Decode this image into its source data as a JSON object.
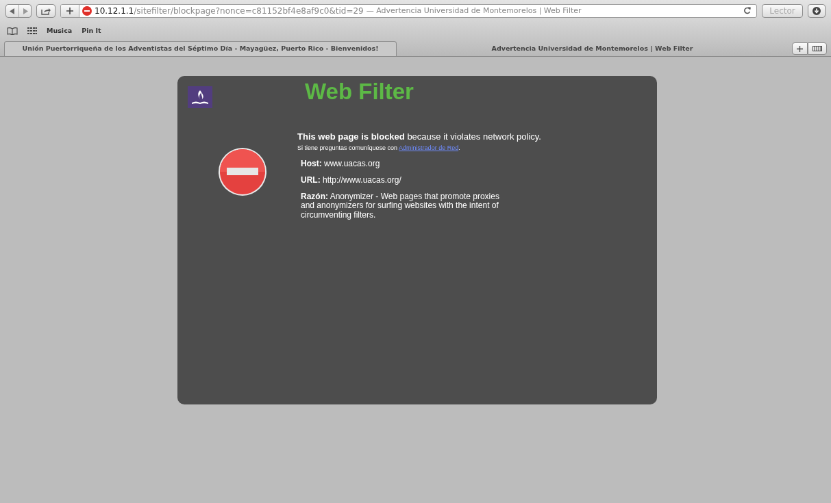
{
  "toolbar": {
    "address": {
      "host": "10.12.1.1",
      "path": "/sitefilter/blockpage?nonce=c81152bf4e8af9c0&tid=29",
      "title": "— Advertencia Universidad de Montemorelos | Web Filter"
    },
    "reader_button": "Lector"
  },
  "bookmarks": [
    "Musica",
    "Pin It"
  ],
  "tabs": [
    {
      "label": "Unión Puertorriqueña de los Adventistas del Séptimo Día - Mayagüez, Puerto Rico - Bienvenidos!",
      "selected": false
    },
    {
      "label": "Advertencia Universidad de Montemorelos | Web Filter",
      "selected": true
    }
  ],
  "page": {
    "heading": "Web Filter",
    "message": "**This web page is blocked** because it violates network policy.",
    "contact": {
      "text": "Si tiene preguntas comuníquese con ",
      "link": "Administrador de Red",
      "end": "."
    },
    "details": [
      "**Host:** www.uacas.org",
      "**URL:** http://www.uacas.org/",
      "**Razón:** Anonymizer - Web pages that promote proxies and anonymizers for surfing websites with the intent of circumventing filters."
    ]
  }
}
